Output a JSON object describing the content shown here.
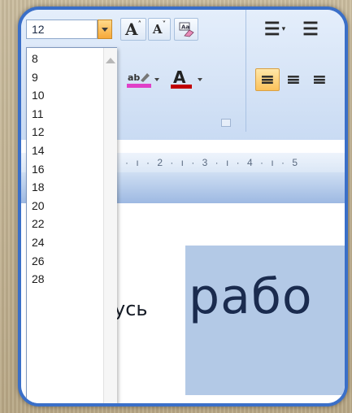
{
  "ribbon": {
    "font_size_value": "12",
    "grow_font_label": "A",
    "shrink_font_label": "A",
    "align_left_glyph": "≡",
    "align_center_glyph": "≡",
    "align_right_glyph": "≡",
    "bullets_glyph": "☰",
    "numbering_glyph": "☰"
  },
  "ruler": {
    "text": "· ı · 2 · ı · 3 · ı · 4 · ı · 5"
  },
  "font_size_dropdown": {
    "options": [
      "8",
      "9",
      "10",
      "11",
      "12",
      "14",
      "16",
      "18",
      "20",
      "22",
      "24",
      "26",
      "28"
    ],
    "selected": "12"
  },
  "document": {
    "word_small": "усь",
    "word_large": "рабо"
  },
  "colors": {
    "frame_border": "#3a6fc8",
    "highlight_fill": "#b3c9e6",
    "text_highlight_color": "#e040c8",
    "font_color": "#c00000",
    "dropdown_arrow": "#f6a93a"
  }
}
